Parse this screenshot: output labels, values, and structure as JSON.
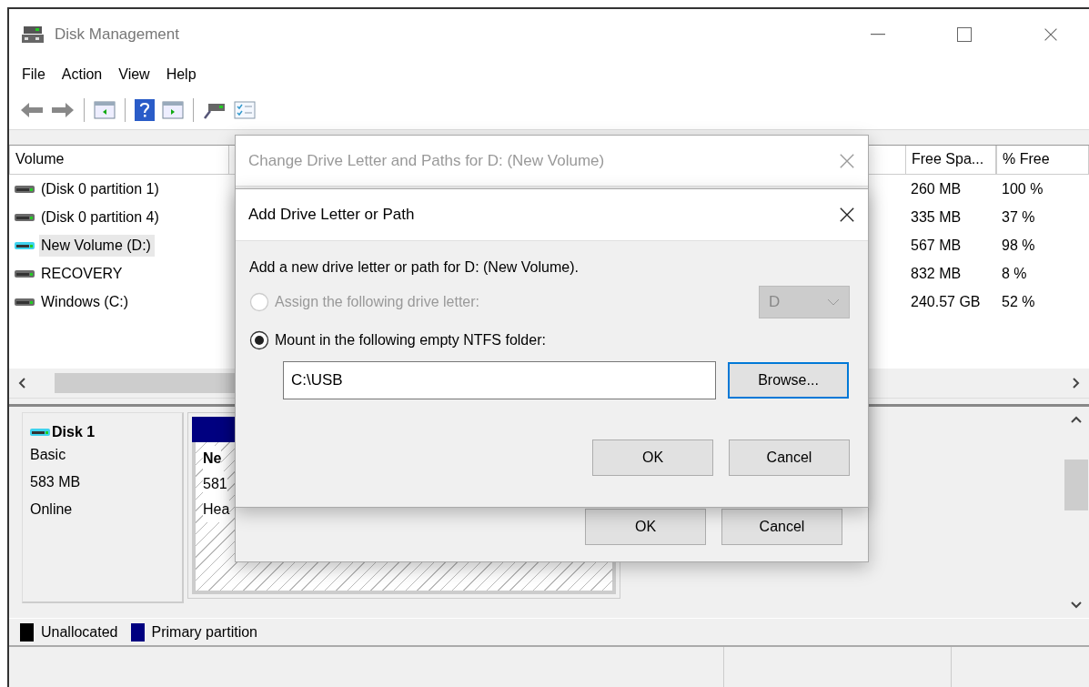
{
  "window": {
    "title": "Disk Management"
  },
  "menu": [
    "File",
    "Action",
    "View",
    "Help"
  ],
  "volume_table": {
    "columns": [
      "Volume",
      "Free Spa...",
      "% Free"
    ],
    "rows": [
      {
        "volume": "(Disk 0 partition 1)",
        "free_space": "260 MB",
        "percent_free": "100 %",
        "selected": false,
        "color": "#6b6b6b"
      },
      {
        "volume": "(Disk 0 partition 4)",
        "free_space": "335 MB",
        "percent_free": "37 %",
        "selected": false,
        "color": "#6b6b6b"
      },
      {
        "volume": "New Volume (D:)",
        "free_space": "567 MB",
        "percent_free": "98 %",
        "selected": true,
        "color": "#3fd3ee"
      },
      {
        "volume": "RECOVERY",
        "free_space": "832 MB",
        "percent_free": "8 %",
        "selected": false,
        "color": "#6b6b6b"
      },
      {
        "volume": "Windows (C:)",
        "free_space": "240.57 GB",
        "percent_free": "52 %",
        "selected": false,
        "color": "#6b6b6b"
      }
    ]
  },
  "disk": {
    "name": "Disk 1",
    "type": "Basic",
    "size": "583 MB",
    "status": "Online",
    "partition_lines": [
      "Ne",
      "581",
      "Hea"
    ]
  },
  "legend": [
    {
      "label": "Unallocated",
      "color": "#000000"
    },
    {
      "label": "Primary partition",
      "color": "#000080"
    }
  ],
  "change_dialog": {
    "title": "Change Drive Letter and Paths for D: (New Volume)",
    "buttons": [
      "OK",
      "Cancel"
    ]
  },
  "add_dialog": {
    "title": "Add Drive Letter or Path",
    "prompt": "Add a new drive letter or path for D: (New Volume).",
    "options": [
      {
        "label": "Assign the following drive letter:",
        "selected": false,
        "disabled": true
      },
      {
        "label": "Mount in the following empty NTFS folder:",
        "selected": true,
        "disabled": false
      }
    ],
    "drive_letter": {
      "value": "D",
      "disabled": true
    },
    "folder_path": {
      "value": "C:\\USB"
    },
    "browse_button": {
      "label": "Browse...",
      "focused": true
    },
    "buttons": [
      "OK",
      "Cancel"
    ]
  }
}
